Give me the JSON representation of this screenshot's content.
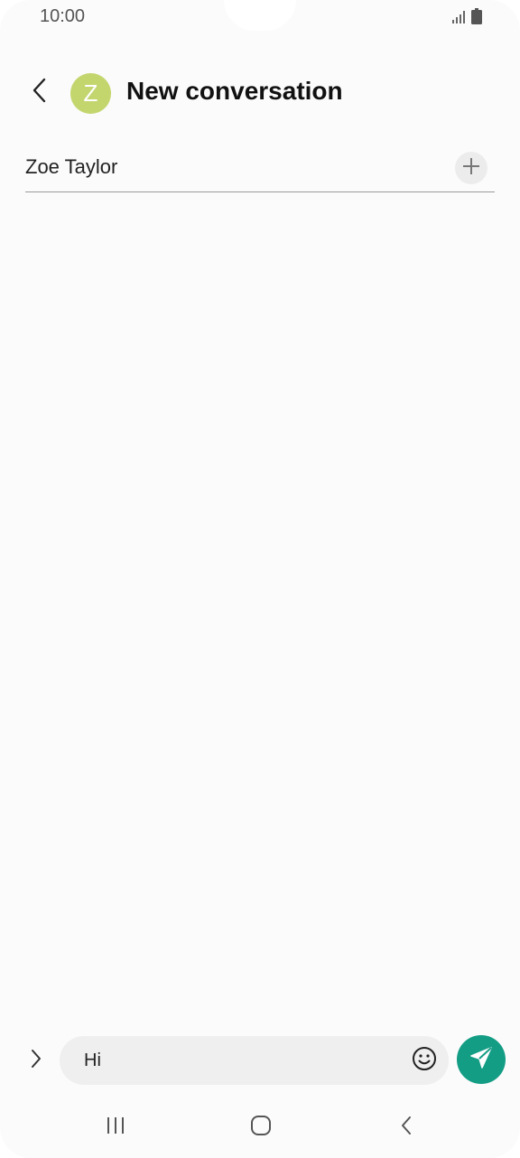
{
  "status_bar": {
    "time": "10:00",
    "signal_icon": "signal-icon",
    "battery_icon": "battery-icon"
  },
  "header": {
    "back_icon": "chevron-left-icon",
    "avatar_letter": "Z",
    "avatar_color": "#c3d66e",
    "title": "New conversation"
  },
  "recipient": {
    "name": "Zoe Taylor",
    "add_icon": "plus-icon"
  },
  "compose": {
    "expand_icon": "chevron-right-icon",
    "message_value": "Hi",
    "emoji_icon": "smiley-icon",
    "send_icon": "send-icon",
    "send_color": "#149d85"
  },
  "nav_bar": {
    "recents_icon": "recents-icon",
    "home_icon": "home-icon",
    "back_icon": "back-icon"
  }
}
